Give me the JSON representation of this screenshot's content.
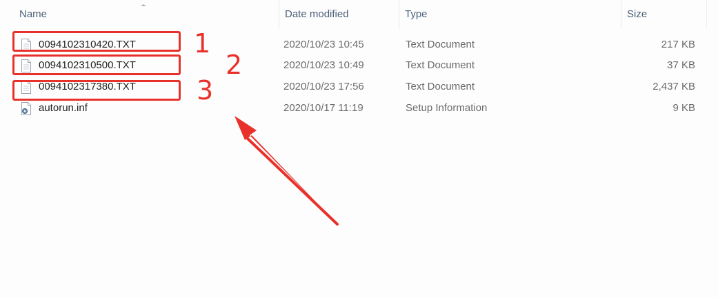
{
  "columns": {
    "name": "Name",
    "date_modified": "Date modified",
    "type": "Type",
    "size": "Size"
  },
  "files": [
    {
      "name": "0094102310420.TXT",
      "date": "2020/10/23 10:45",
      "type": "Text Document",
      "size": "217 KB",
      "icon": "text-file-icon"
    },
    {
      "name": "0094102310500.TXT",
      "date": "2020/10/23 10:49",
      "type": "Text Document",
      "size": "37 KB",
      "icon": "text-file-icon"
    },
    {
      "name": "0094102317380.TXT",
      "date": "2020/10/23 17:56",
      "type": "Text Document",
      "size": "2,437 KB",
      "icon": "text-file-icon"
    },
    {
      "name": "autorun.inf",
      "date": "2020/10/17 11:19",
      "type": "Setup Information",
      "size": "9 KB",
      "icon": "setup-file-icon"
    }
  ],
  "annotations": {
    "labels": [
      "1",
      "2",
      "3"
    ],
    "color": "#e8312a"
  }
}
